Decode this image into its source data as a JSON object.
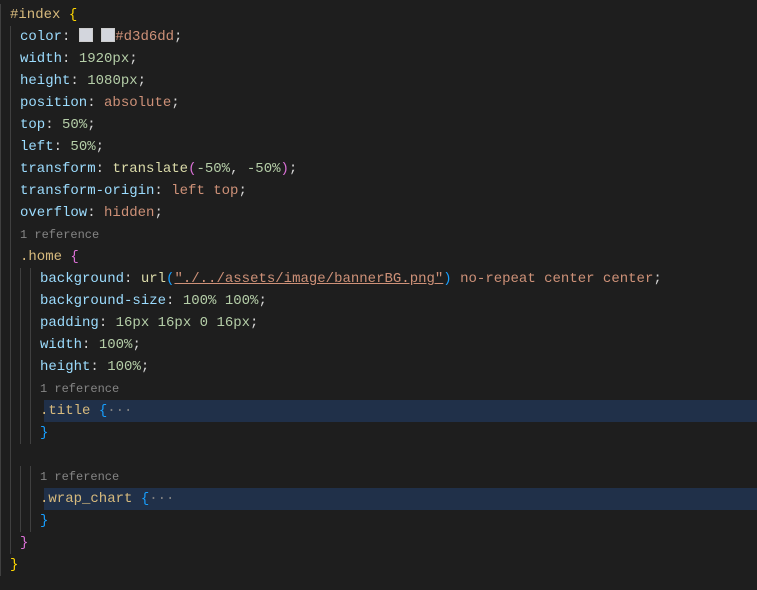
{
  "lines": {
    "l0": "#index",
    "l1_prop": "color",
    "l1_val": "#d3d6dd",
    "l2_prop": "width",
    "l2_val": "1920px",
    "l3_prop": "height",
    "l3_val": "1080px",
    "l4_prop": "position",
    "l4_val": "absolute",
    "l5_prop": "top",
    "l5_val": "50%",
    "l6_prop": "left",
    "l6_val": "50%",
    "l7_prop": "transform",
    "l7_fn": "translate",
    "l7_a": "-50%",
    "l7_b": "-50%",
    "l8_prop": "transform-origin",
    "l8_val": "left top",
    "l9_prop": "overflow",
    "l9_val": "hidden",
    "ref": "1 reference",
    "l10_sel": ".home",
    "l11_prop": "background",
    "l11_fn": "url",
    "l11_str": "\"./../assets/image/bannerBG.png\"",
    "l11_rest": "no-repeat center center",
    "l12_prop": "background-size",
    "l12_val": "100% 100%",
    "l13_prop": "padding",
    "l13_val": "16px 16px 0 16px",
    "l14_prop": "width",
    "l14_val": "100%",
    "l15_prop": "height",
    "l15_val": "100%",
    "l16_sel": ".title",
    "l17_sel": ".wrap_chart",
    "dots": "···"
  }
}
